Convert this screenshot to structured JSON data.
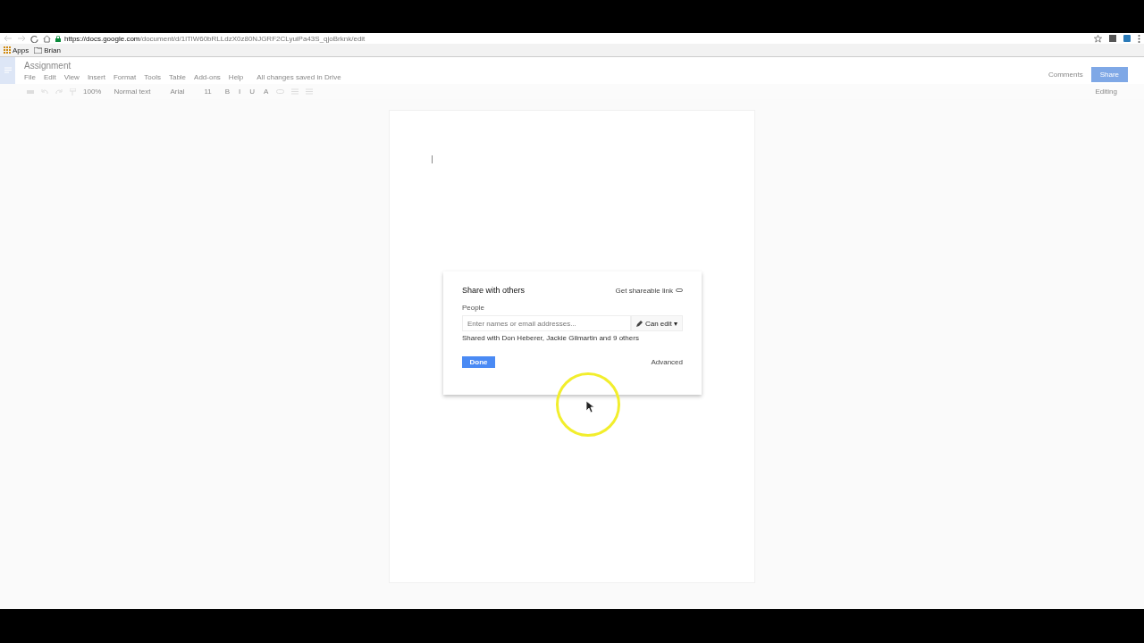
{
  "browser": {
    "url_host": "https://docs.google.com",
    "url_path": "/document/d/1lTlW60bRLLdzX0z80NJGRF2CLyuiPa43S_qjoBrknk/edit",
    "bookmarks": [
      {
        "label": "Apps",
        "kind": "apps"
      },
      {
        "label": "Brian",
        "kind": "folder"
      }
    ]
  },
  "doc": {
    "title": "Assignment",
    "menu": [
      "File",
      "Edit",
      "View",
      "Insert",
      "Format",
      "Tools",
      "Table",
      "Add-ons",
      "Help"
    ],
    "save_status": "All changes saved in Drive",
    "comments": "Comments",
    "share": "Share"
  },
  "toolbar": {
    "zoom": "100%",
    "style": "Normal text",
    "font": "Arial",
    "size": "11",
    "format": [
      "B",
      "I",
      "U",
      "A"
    ],
    "mode": "Editing"
  },
  "dialog": {
    "title": "Share with others",
    "link": "Get shareable link",
    "people_label": "People",
    "placeholder": "Enter names or email addresses...",
    "permission": "Can edit",
    "permission_caret": "▾",
    "shared_with": "Shared with Don Heberer, Jackie Gilmartin and 9 others",
    "done": "Done",
    "advanced": "Advanced"
  }
}
